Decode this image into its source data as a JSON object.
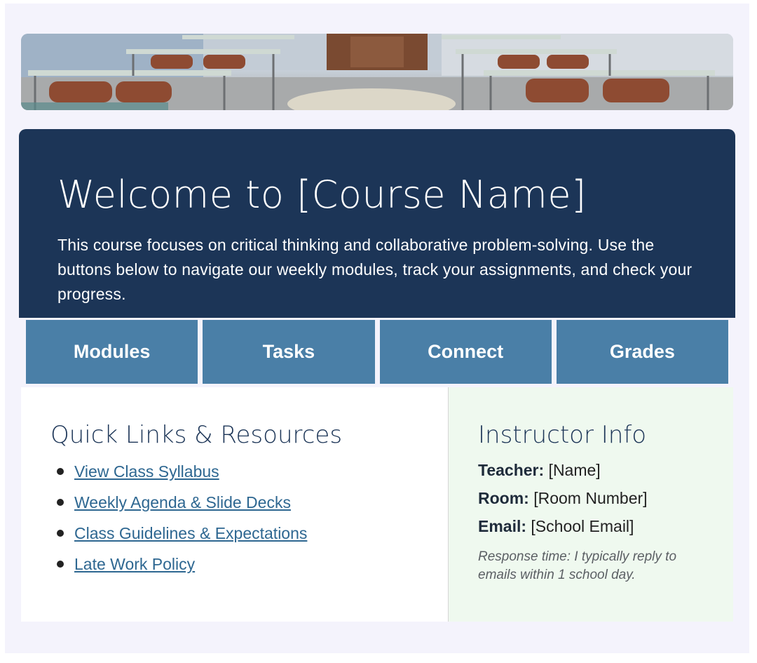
{
  "banner": {
    "image_desc_icon": "classroom-photo"
  },
  "hero": {
    "title": "Welcome to [Course Name]",
    "description": "This course focuses on critical thinking and collaborative problem-solving. Use the buttons below to navigate our weekly modules, track your assignments, and check your progress."
  },
  "nav": {
    "buttons": [
      {
        "label": "Modules"
      },
      {
        "label": "Tasks"
      },
      {
        "label": "Connect"
      },
      {
        "label": "Grades"
      }
    ]
  },
  "quick_links": {
    "title": "Quick Links & Resources",
    "items": [
      {
        "label": "View Class Syllabus"
      },
      {
        "label": "Weekly Agenda & Slide Decks"
      },
      {
        "label": "Class Guidelines & Expectations"
      },
      {
        "label": "Late Work Policy"
      }
    ]
  },
  "instructor": {
    "title": "Instructor Info",
    "teacher_label": "Teacher:",
    "teacher_value": " [Name]",
    "room_label": "Room:",
    "room_value": " [Room Number]",
    "email_label": "Email:",
    "email_value": " [School Email]",
    "note": "Response time: I typically reply to emails within 1 school day."
  },
  "colors": {
    "hero_bg": "#1c3557",
    "nav_button_bg": "#4a7fa7",
    "link": "#2e6791",
    "instructor_bg": "#eff9ef",
    "page_bg": "#f4f3fc"
  }
}
